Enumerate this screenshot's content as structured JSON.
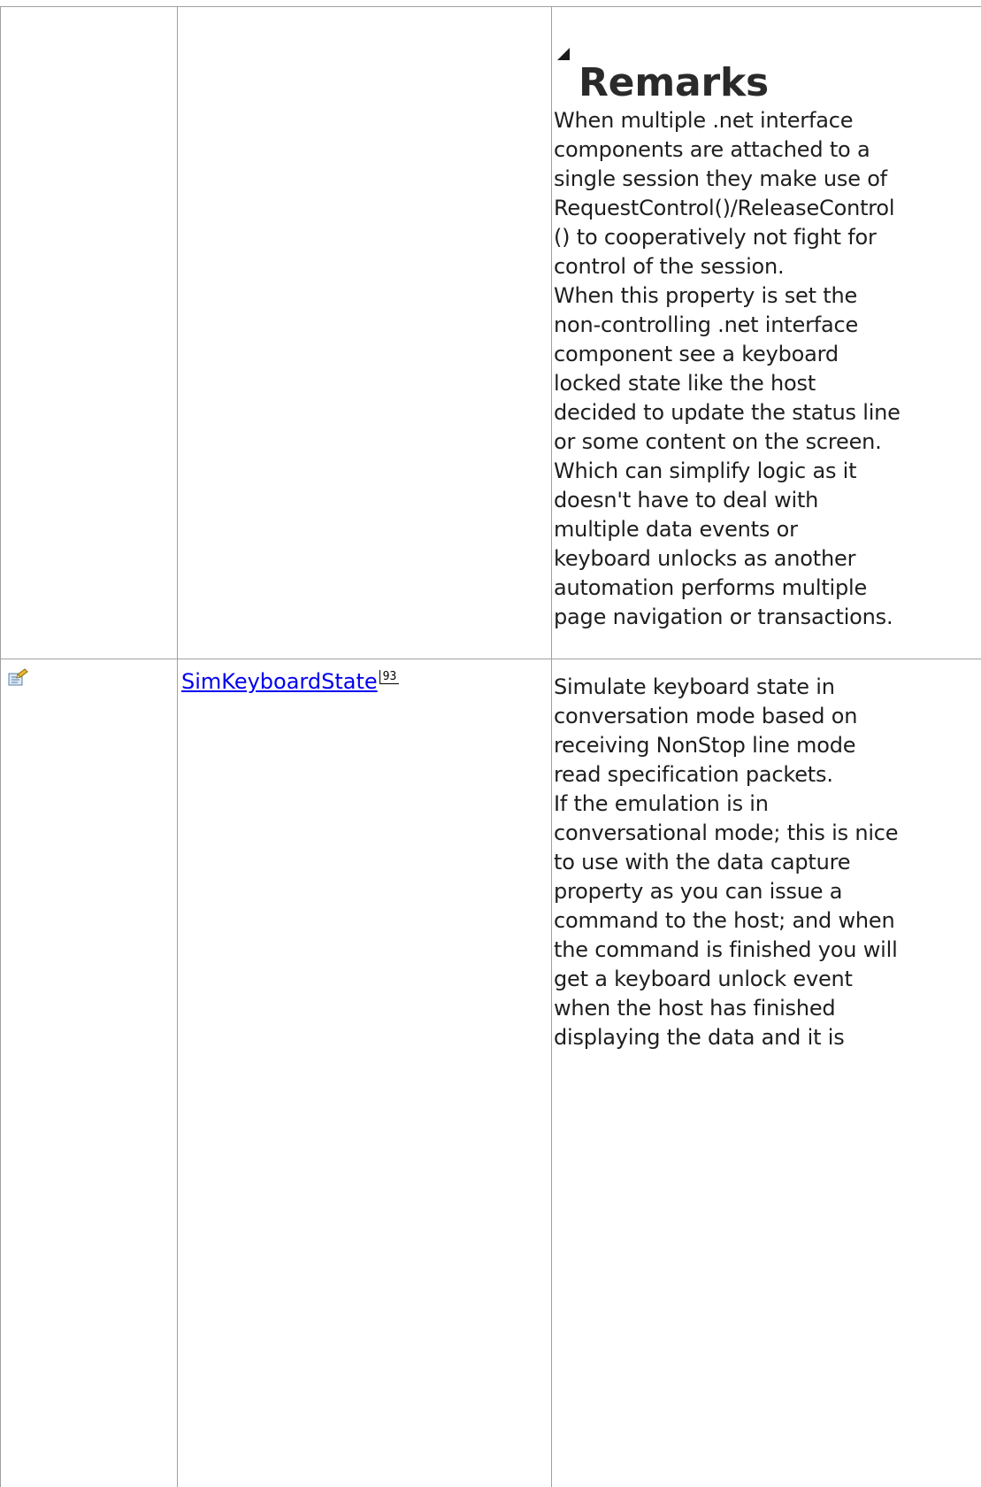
{
  "remarks": {
    "heading": "Remarks",
    "lines": [
      "When multiple .net interface",
      "components are attached to a",
      "single session they make use of",
      "RequestControl()/ReleaseControl",
      "() to cooperatively not fight for",
      "control of the session.",
      "When this property is set the",
      "non-controlling .net interface",
      "component see a keyboard",
      "locked state like the host",
      "decided to update the status line",
      "or some content on the screen.",
      "Which can simplify logic as it",
      "doesn't have to deal with",
      "multiple data events or",
      "keyboard unlocks as another",
      "automation performs multiple",
      "page navigation or transactions."
    ]
  },
  "row": {
    "icon": "property-icon",
    "name": "SimKeyboardState",
    "page": "93",
    "description_lines": [
      "Simulate keyboard state in",
      "conversation mode based on",
      "receiving NonStop line mode",
      "read specification packets.",
      "If the emulation is in",
      "conversational mode; this is nice",
      "to use with the data capture",
      "property as you can issue a",
      "command to the host; and when",
      "the command is finished you will",
      "get a keyboard unlock event",
      "when the host has finished",
      "displaying the data and it is"
    ]
  }
}
